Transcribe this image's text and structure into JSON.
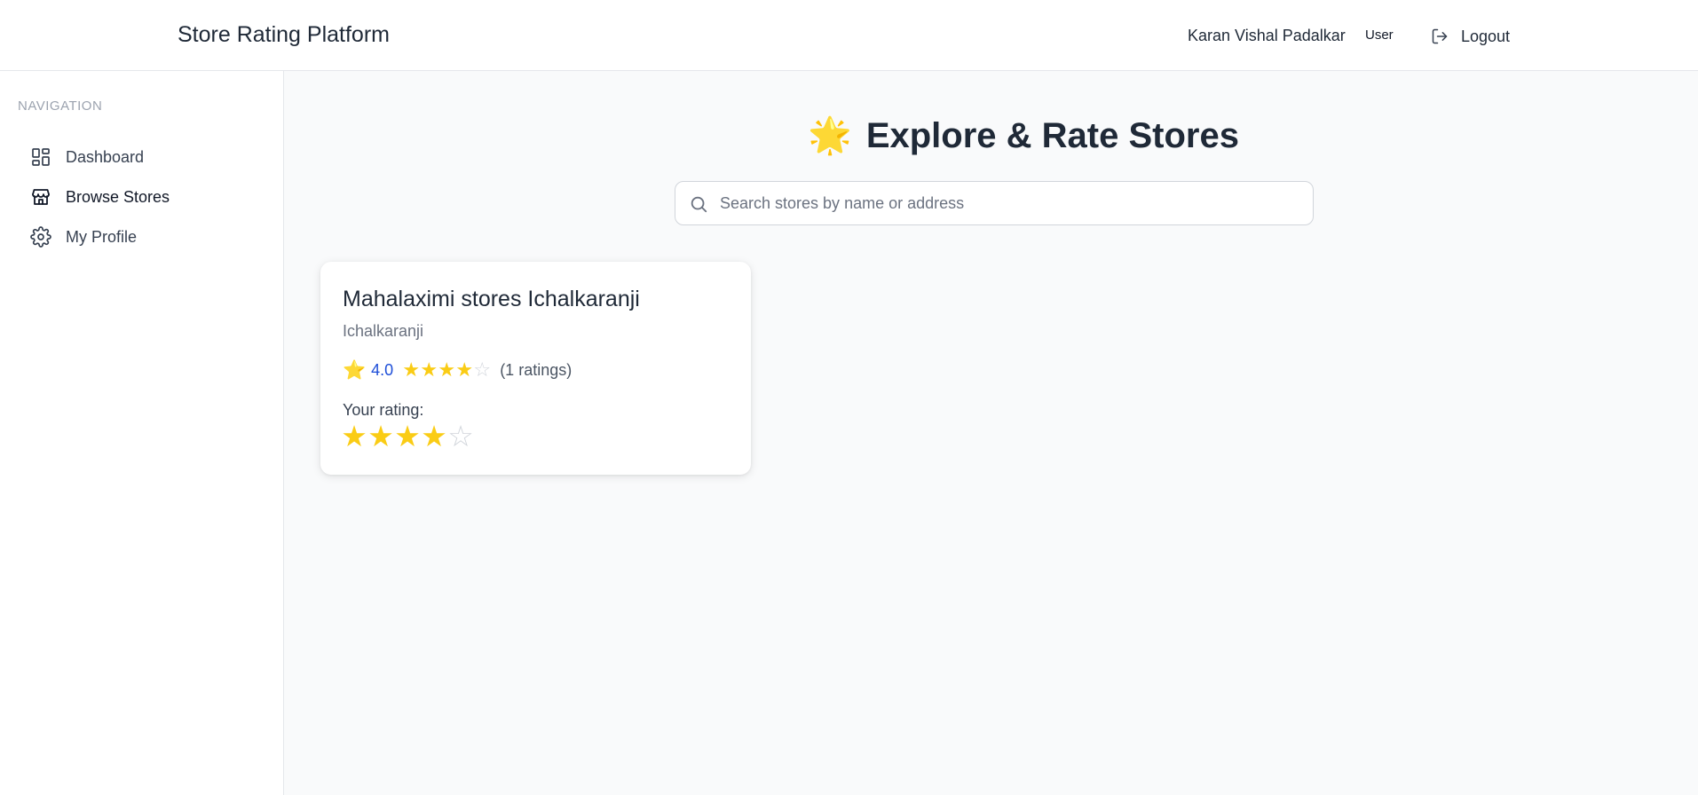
{
  "header": {
    "app_title": "Store Rating Platform",
    "user_name": "Karan Vishal Padalkar",
    "role": "User",
    "logout_label": "Logout"
  },
  "sidebar": {
    "heading": "NAVIGATION",
    "items": [
      {
        "label": "Dashboard",
        "icon": "dashboard-grid-icon",
        "active": false
      },
      {
        "label": "Browse Stores",
        "icon": "store-icon",
        "active": true
      },
      {
        "label": "My Profile",
        "icon": "gear-icon",
        "active": false
      }
    ]
  },
  "main": {
    "title_icon": "🌟",
    "title": "Explore & Rate Stores",
    "search": {
      "placeholder": "Search stores by name or address",
      "value": ""
    }
  },
  "stores": [
    {
      "name": "Mahalaximi stores Ichalkaranji",
      "address": "Ichalkaranji",
      "average_icon": "⭐",
      "average_rating": "4.0",
      "average_stars": 4,
      "ratings_count": "(1 ratings)",
      "your_rating_label": "Your rating:",
      "your_rating": 4,
      "max_stars": 5
    }
  ],
  "colors": {
    "star_filled": "#facc15",
    "star_empty": "#d1d5db",
    "rating_value": "#1d4ed8"
  }
}
